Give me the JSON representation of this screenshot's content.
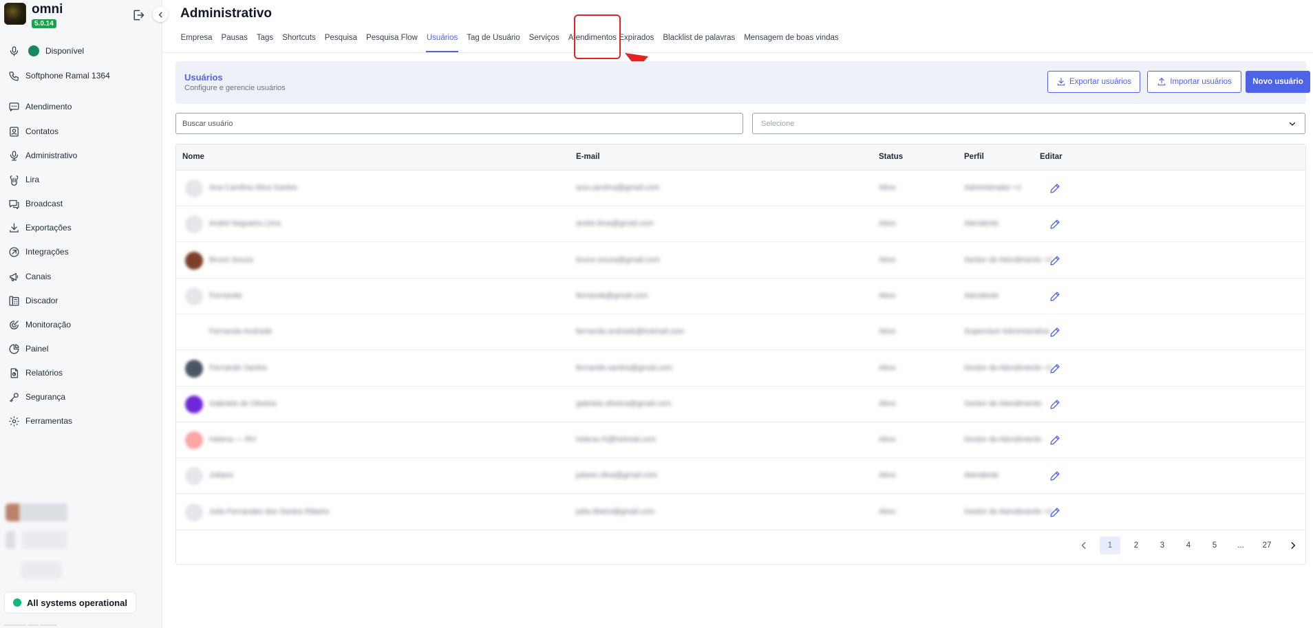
{
  "brand": {
    "name": "omni",
    "version": "5.0.14"
  },
  "sidebar": {
    "presence": "Disponível",
    "softphone": "Softphone Ramal 1364",
    "items": [
      {
        "label": "Atendimento",
        "icon": "chat-icon"
      },
      {
        "label": "Contatos",
        "icon": "contacts-icon"
      },
      {
        "label": "Administrativo",
        "icon": "admin-icon"
      },
      {
        "label": "Lira",
        "icon": "lira-icon"
      },
      {
        "label": "Broadcast",
        "icon": "broadcast-icon"
      },
      {
        "label": "Exportações",
        "icon": "download-icon"
      },
      {
        "label": "Integrações",
        "icon": "integrations-icon"
      },
      {
        "label": "Canais",
        "icon": "megaphone-icon"
      },
      {
        "label": "Discador",
        "icon": "dialer-icon"
      },
      {
        "label": "Monitoração",
        "icon": "target-icon"
      },
      {
        "label": "Painel",
        "icon": "dashboard-icon"
      },
      {
        "label": "Relatórios",
        "icon": "report-icon"
      },
      {
        "label": "Segurança",
        "icon": "key-icon"
      },
      {
        "label": "Ferramentas",
        "icon": "gear-icon"
      }
    ],
    "status": "All systems operational"
  },
  "page": {
    "title": "Administrativo"
  },
  "tabs": [
    {
      "label": "Empresa"
    },
    {
      "label": "Pausas"
    },
    {
      "label": "Tags"
    },
    {
      "label": "Shortcuts"
    },
    {
      "label": "Pesquisa"
    },
    {
      "label": "Pesquisa Flow"
    },
    {
      "label": "Usuários",
      "active": true
    },
    {
      "label": "Tag de Usuário"
    },
    {
      "label": "Serviços"
    },
    {
      "label": "Atendimentos Expirados"
    },
    {
      "label": "Blacklist de palavras"
    },
    {
      "label": "Mensagem de boas vindas"
    }
  ],
  "section": {
    "title": "Usuários",
    "subtitle": "Configure e gerencie usuários",
    "export_label": "Exportar usuários",
    "import_label": "Importar usuários",
    "new_label": "Novo usuário"
  },
  "filters": {
    "search_placeholder": "Buscar usuário",
    "select_placeholder": "Selecione"
  },
  "table": {
    "columns": [
      "Nome",
      "E-mail",
      "Status",
      "Perfil",
      "Editar"
    ],
    "rows": [
      {
        "name": "Ana Carolina Silva Santos",
        "email": "ana.carolina@gmail.com",
        "status": "Ativo",
        "profile": "Administrador +1",
        "avatar_color": "#e5e7eb"
      },
      {
        "name": "André Nogueira Lima",
        "email": "andre.lima@gmail.com",
        "status": "Ativo",
        "profile": "Atendente",
        "avatar_color": "#e5e7eb"
      },
      {
        "name": "Bruno Souza",
        "email": "bruno.souza@gmail.com",
        "status": "Ativo",
        "profile": "Gestor de Atendimento +2",
        "avatar_color": "#7c3f2a"
      },
      {
        "name": "Fernanda",
        "email": "fernanda@gmail.com",
        "status": "Ativo",
        "profile": "Atendente",
        "avatar_color": "#e5e7eb"
      },
      {
        "name": "Fernanda Andrade",
        "email": "fernanda.andrade@hotmail.com",
        "status": "Ativo",
        "profile": "Supervisor Administrativo",
        "avatar_color": "#ffffff"
      },
      {
        "name": "Fernando Santos",
        "email": "fernando.santos@gmail.com",
        "status": "Ativo",
        "profile": "Gestor de Atendimento +1",
        "avatar_color": "#4b5563"
      },
      {
        "name": "Gabriela de Oliveira",
        "email": "gabriela.oliveira@gmail.com",
        "status": "Ativo",
        "profile": "Gestor de Atendimento",
        "avatar_color": "#6d28d9"
      },
      {
        "name": "Helena — RH",
        "email": "helena.rh@hotmail.com",
        "status": "Ativo",
        "profile": "Gestor de Atendimento",
        "avatar_color": "#fca5a5"
      },
      {
        "name": "Juliano",
        "email": "juliano.silva@gmail.com",
        "status": "Ativo",
        "profile": "Atendente",
        "avatar_color": "#e5e7eb"
      },
      {
        "name": "Julia Fernandes dos Santos Ribeiro",
        "email": "julia.ribeiro@gmail.com",
        "status": "Ativo",
        "profile": "Gestor de Atendimento +2",
        "avatar_color": "#e5e7eb"
      }
    ]
  },
  "pagination": {
    "pages": [
      "1",
      "2",
      "3",
      "4",
      "5",
      "...",
      "27"
    ],
    "current": "1"
  },
  "colors": {
    "accent": "#4f63e6",
    "success": "#16a34a",
    "highlight": "#e02424"
  }
}
